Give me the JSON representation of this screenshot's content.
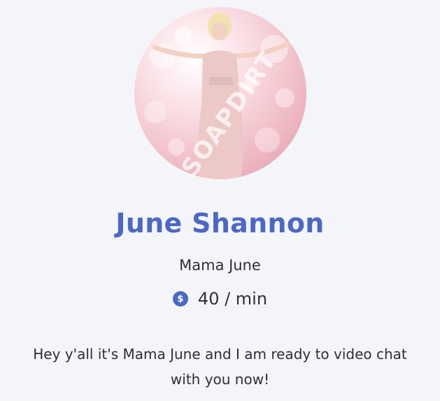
{
  "profile": {
    "name": "June Shannon",
    "nickname": "Mama June",
    "rate": {
      "currency_icon": "dollar-icon",
      "currency_symbol": "$",
      "text": "40 / min"
    },
    "bio": "Hey y'all it's Mama June and I am ready to video chat with you now!",
    "avatar": {
      "watermark": "SOAPDIRT"
    }
  },
  "colors": {
    "accent": "#4c68c4",
    "background": "#f4f5f9",
    "text": "#2f2f35"
  }
}
